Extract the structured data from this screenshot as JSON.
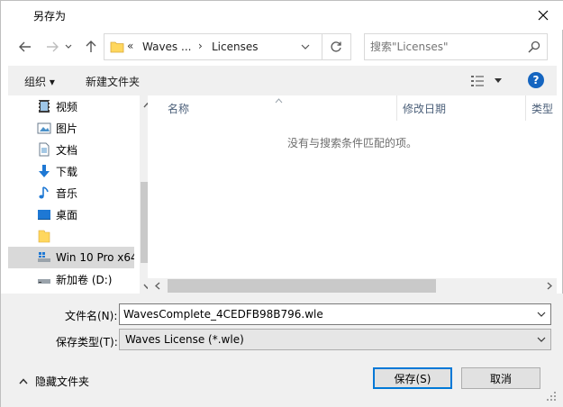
{
  "window": {
    "title": "另存为"
  },
  "address": {
    "overflow": "«",
    "crumbs": [
      "Waves ...",
      "Licenses"
    ],
    "separator": "›"
  },
  "search": {
    "placeholder": "搜索\"Licenses\""
  },
  "toolbar": {
    "organize_label": "组织 ▾",
    "new_folder_label": "新建文件夹"
  },
  "help": {
    "label": "?"
  },
  "nav": {
    "items": [
      {
        "label": "视频",
        "icon": "video-icon"
      },
      {
        "label": "图片",
        "icon": "pictures-icon"
      },
      {
        "label": "文档",
        "icon": "documents-icon"
      },
      {
        "label": "下载",
        "icon": "download-icon"
      },
      {
        "label": "音乐",
        "icon": "music-icon"
      },
      {
        "label": "桌面",
        "icon": "desktop-icon"
      },
      {
        "label": "",
        "icon": "folder-icon"
      },
      {
        "label": "Win 10 Pro x64",
        "icon": "drive-icon",
        "selected": true
      },
      {
        "label": "新加卷 (D:)",
        "icon": "drive-icon"
      }
    ]
  },
  "files": {
    "columns": [
      "名称",
      "修改日期",
      "类型"
    ],
    "empty_message": "没有与搜索条件匹配的项。"
  },
  "form": {
    "filename_label": "文件名(N):",
    "filename_value": "WavesComplete_4CEDFB98B796.wle",
    "filetype_label": "保存类型(T):",
    "filetype_value": "Waves License (*.wle)"
  },
  "footer": {
    "hide_folders_label": "隐藏文件夹",
    "save_label": "保存(S)",
    "cancel_label": "取消"
  },
  "colors": {
    "accent": "#0078d7",
    "help": "#1565c0",
    "selected_bg": "#d9d9d9",
    "folder": "#ffd75e"
  }
}
